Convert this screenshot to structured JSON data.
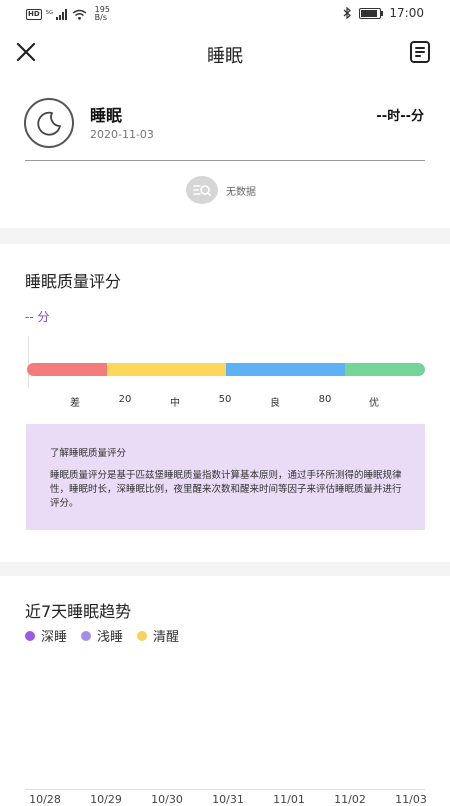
{
  "status_bar": {
    "network_type": "HD",
    "signal": "5G",
    "speed_value": "195",
    "speed_unit": "B/s",
    "time": "17:00",
    "battery_level": 0.9
  },
  "nav": {
    "title": "睡眠"
  },
  "summary": {
    "title": "睡眠",
    "date": "2020-11-03",
    "duration": "--时--分",
    "no_data": "无数据"
  },
  "quality": {
    "title": "睡眠质量评分",
    "score": "-- 分",
    "segments": [
      {
        "color": "#f27c7c",
        "from": 0,
        "to": 20
      },
      {
        "color": "#fbd85a",
        "from": 20,
        "to": 50
      },
      {
        "color": "#5fb1f5",
        "from": 50,
        "to": 80
      },
      {
        "color": "#74d49a",
        "from": 80,
        "to": 100
      }
    ],
    "labels": [
      "差",
      "20",
      "中",
      "50",
      "良",
      "80",
      "优"
    ],
    "info_title": "了解睡眠质量评分",
    "info_body": "睡眠质量评分是基于匹兹堡睡眠质量指数计算基本原则，通过手环所测得的睡眠规律性，睡眠时长，深睡眠比例，夜里醒来次数和醒来时间等因子来评估睡眠质量并进行评分。"
  },
  "trend": {
    "title": "近7天睡眠趋势",
    "legend": [
      {
        "label": "深睡",
        "color": "#9a5be0"
      },
      {
        "label": "浅睡",
        "color": "#a98ae8"
      },
      {
        "label": "清醒",
        "color": "#f8d25a"
      }
    ],
    "dates": [
      "10/28",
      "10/29",
      "10/30",
      "10/31",
      "11/01",
      "11/02",
      "11/03"
    ]
  }
}
